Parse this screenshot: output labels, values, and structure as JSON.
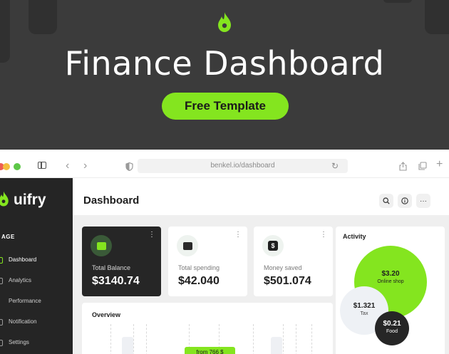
{
  "hero": {
    "title": "Finance Dashboard",
    "cta": "Free Template"
  },
  "browser": {
    "url": "benkel.io/dashboard"
  },
  "sidebar": {
    "brand": "uifry",
    "section_label": "AGE",
    "items": [
      {
        "label": "Dashboard",
        "active": true
      },
      {
        "label": "Analytics",
        "active": false
      },
      {
        "label": "Performance",
        "active": false
      },
      {
        "label": "Notification",
        "active": false
      },
      {
        "label": "Settings",
        "active": false
      }
    ]
  },
  "header": {
    "title": "Dashboard",
    "icons": [
      "search-icon",
      "info-icon",
      "more-icon"
    ]
  },
  "cards": [
    {
      "label": "Total Balance",
      "value": "$3140.74",
      "icon": "wallet-icon"
    },
    {
      "label": "Total spending",
      "value": "$42.040",
      "icon": "wallet-icon"
    },
    {
      "label": "Money saved",
      "value": "$501.074",
      "icon": "dollar-icon"
    }
  ],
  "overview": {
    "title": "Overview",
    "pill": "from 766 $"
  },
  "activity": {
    "title": "Activity",
    "bubbles": [
      {
        "value": "$3.20",
        "label": "Online shop"
      },
      {
        "value": "$1.321",
        "label": "Tax"
      },
      {
        "value": "$0.21",
        "label": "Food"
      }
    ]
  },
  "colors": {
    "accent": "#84e51f",
    "dark": "#262626",
    "hero_bg": "#3b3b3b"
  }
}
